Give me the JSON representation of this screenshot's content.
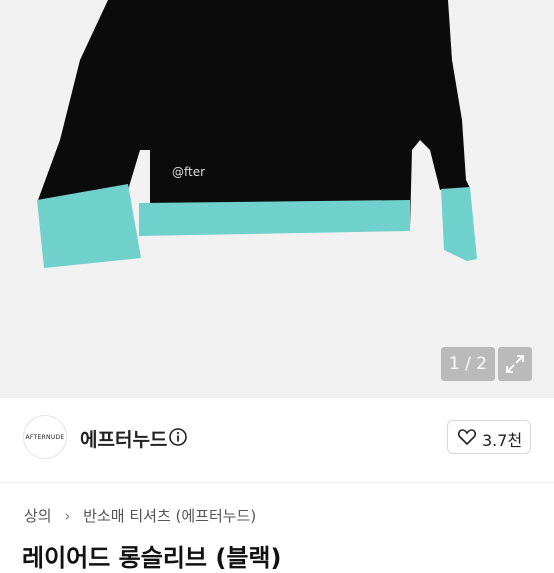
{
  "gallery": {
    "counter": "1 / 2",
    "garment_logo_text": "@fter"
  },
  "brand": {
    "logo_text": "AFTERNUDE",
    "name": "에프터누드",
    "likes": "3.7천"
  },
  "breadcrumb": {
    "level1": "상의",
    "level2": "반소매 티셔츠 (에프터누드)"
  },
  "product": {
    "title": "레이어드 롱슬리브 (블랙)"
  },
  "colors": {
    "body": "#0b0b0b",
    "cuff": "#6fd0cc",
    "hero_bg": "#f1f1f1"
  }
}
